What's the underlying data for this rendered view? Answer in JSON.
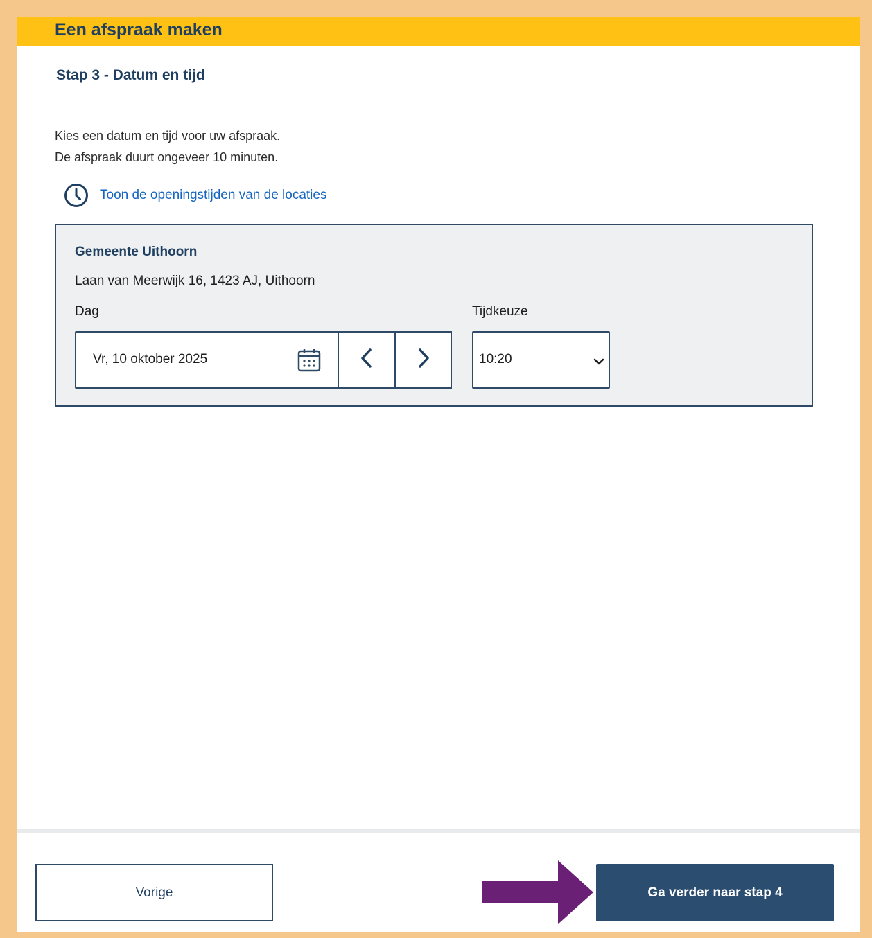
{
  "header": {
    "title": "Een afspraak maken"
  },
  "step": {
    "title": "Stap 3 - Datum en tijd"
  },
  "intro": {
    "line1": "Kies een datum en tijd voor uw afspraak.",
    "line2": "De afspraak duurt ongeveer 10 minuten."
  },
  "opening_hours": {
    "icon": "clock-icon",
    "link_label": "Toon de openingstijden van de locaties"
  },
  "location": {
    "name": "Gemeente Uithoorn",
    "address": "Laan van Meerwijk 16, 1423 AJ, Uithoorn",
    "day_label": "Dag",
    "date_value": "Vr, 10 oktober 2025",
    "calendar_icon": "calendar-icon",
    "prev_icon": "chevron-left-icon",
    "next_icon": "chevron-right-icon",
    "time_label": "Tijdkeuze",
    "time_value": "10:20",
    "time_dropdown_icon": "chevron-down-icon"
  },
  "footer": {
    "prev_label": "Vorige",
    "next_label": "Ga verder naar stap 4",
    "pointer_icon": "arrow-right-icon"
  },
  "colors": {
    "header_bar": "#ffc114",
    "primary": "#2b4d70",
    "frame_border": "#f6c78a",
    "link": "#1565c0",
    "panel_bg": "#eef0f2",
    "pointer_arrow": "#6a2074"
  }
}
